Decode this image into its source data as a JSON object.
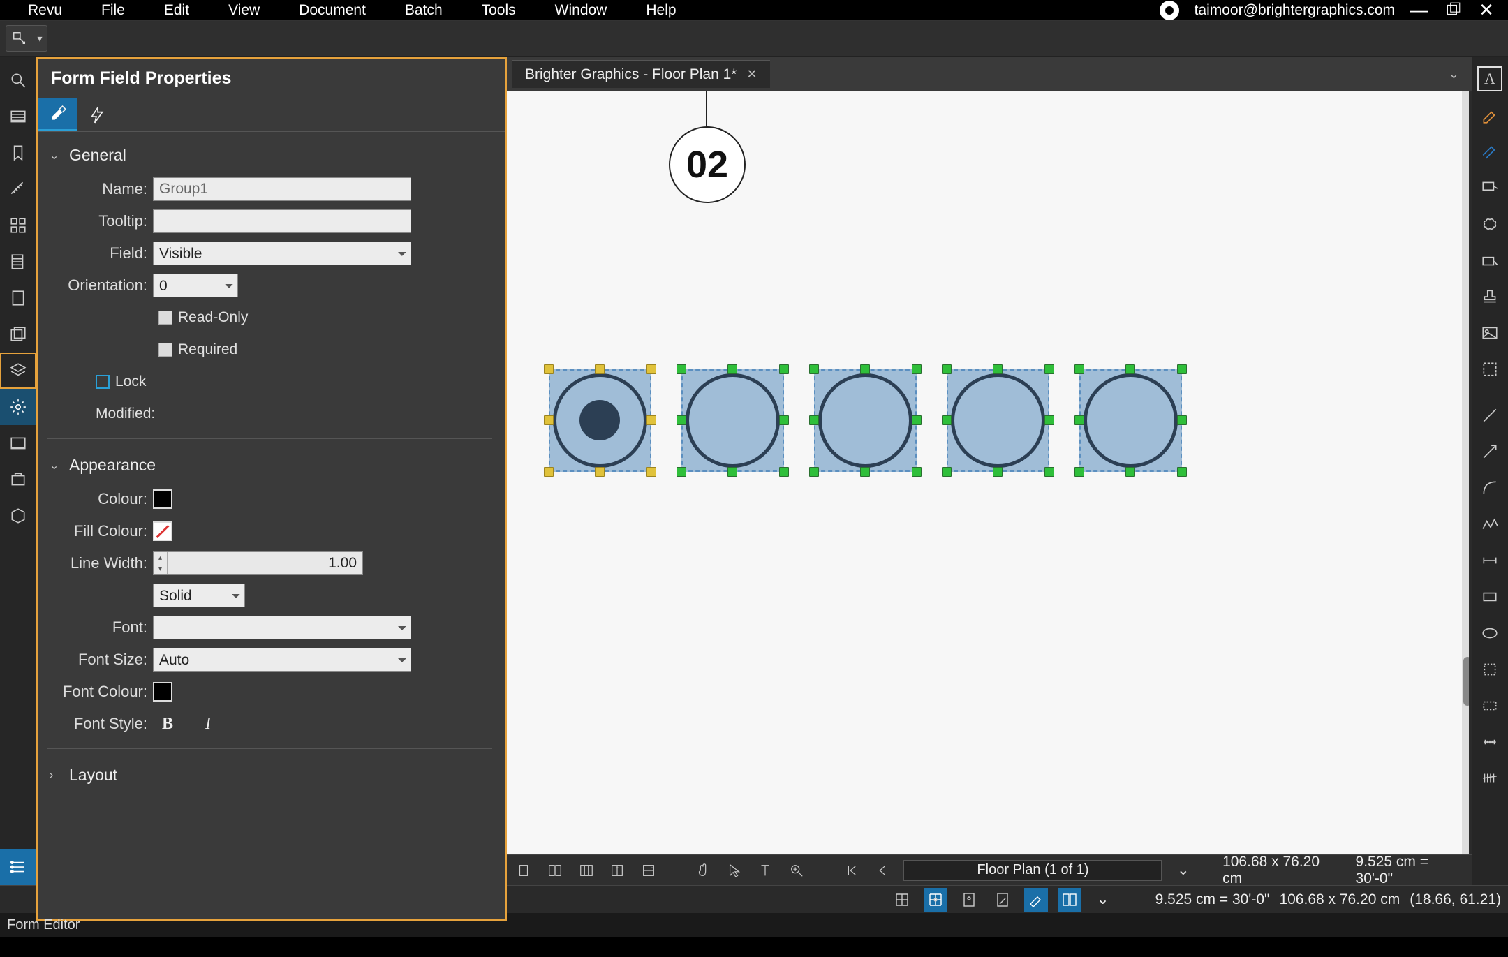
{
  "menubar": {
    "items": [
      "Revu",
      "File",
      "Edit",
      "View",
      "Document",
      "Batch",
      "Tools",
      "Window",
      "Help"
    ],
    "user": "taimoor@brightergraphics.com"
  },
  "doc_tab": {
    "title": "Brighter Graphics - Floor Plan 1*"
  },
  "properties": {
    "title": "Form Field Properties",
    "sections": {
      "general": {
        "label": "General",
        "name_label": "Name:",
        "name_value": "Group1",
        "tooltip_label": "Tooltip:",
        "tooltip_value": "",
        "field_label": "Field:",
        "field_value": "Visible",
        "orientation_label": "Orientation:",
        "orientation_value": "0",
        "readonly_label": "Read-Only",
        "required_label": "Required",
        "lock_label": "Lock",
        "modified_label": "Modified:"
      },
      "appearance": {
        "label": "Appearance",
        "colour_label": "Colour:",
        "fillcolour_label": "Fill Colour:",
        "linewidth_label": "Line Width:",
        "linewidth_value": "1.00",
        "linestyle_value": "Solid",
        "font_label": "Font:",
        "font_value": "",
        "fontsize_label": "Font Size:",
        "fontsize_value": "Auto",
        "fontcolour_label": "Font Colour:",
        "fontstyle_label": "Font Style:"
      },
      "layout": {
        "label": "Layout"
      }
    }
  },
  "canvas": {
    "marker": "02",
    "radio_count": 5
  },
  "docbar": {
    "page": "Floor Plan (1 of 1)",
    "dim1": "106.68 x 76.20 cm",
    "scale1": "9.525 cm = 30'-0\""
  },
  "statusbar": {
    "scale": "9.525 cm = 30'-0\"",
    "dim": "106.68 x 76.20 cm",
    "coord": "(18.66, 61.21)"
  },
  "statusbar2": {
    "mode": "Form Editor"
  }
}
